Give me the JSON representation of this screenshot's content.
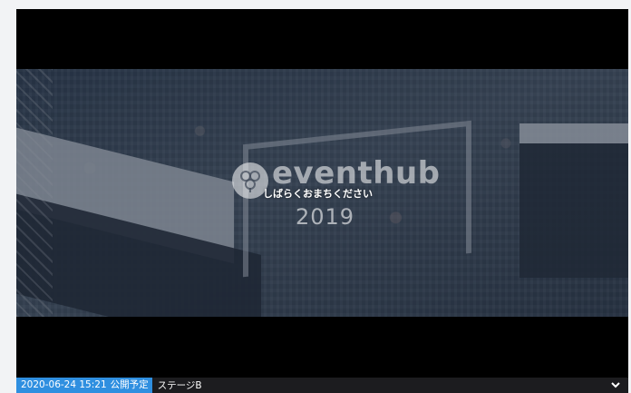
{
  "player": {
    "logo_text": "eventhub",
    "logo_year": "2019",
    "standby_message": "しばらくおまちください"
  },
  "bottom_bar": {
    "scheduled_datetime": "2020-06-24 15:21",
    "scheduled_label": "公開予定",
    "stage_name": "ステージB",
    "accent_color": "#2f8fe0"
  },
  "icons": {
    "logo_mark": "eventhub-logo-icon",
    "dropdown": "chevron-down-icon"
  }
}
